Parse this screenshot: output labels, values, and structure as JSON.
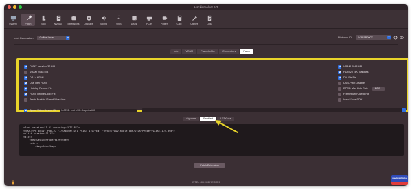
{
  "window": {
    "title": "Hackintool v3.9.3"
  },
  "toolbar": {
    "items": [
      {
        "label": "System",
        "icon": "monitor-icon"
      },
      {
        "label": "Patch",
        "icon": "wrench-icon"
      },
      {
        "label": "Boot",
        "icon": "boot-icon"
      },
      {
        "label": "NVRAM",
        "icon": "nvram-icon"
      },
      {
        "label": "Extensions",
        "icon": "puzzle-icon"
      },
      {
        "label": "Displays",
        "icon": "display-icon"
      },
      {
        "label": "Sound",
        "icon": "speaker-icon"
      },
      {
        "label": "USB",
        "icon": "usb-icon"
      },
      {
        "label": "Disks",
        "icon": "disk-icon"
      },
      {
        "label": "PCIe",
        "icon": "pcie-icon"
      },
      {
        "label": "Power",
        "icon": "power-icon"
      },
      {
        "label": "Calc",
        "icon": "calculator-icon"
      },
      {
        "label": "Utilities",
        "icon": "tools-icon"
      },
      {
        "label": "Logs",
        "icon": "logs-icon"
      }
    ],
    "active_index": 1
  },
  "settings": {
    "intel_generation_label": "Intel Generation",
    "intel_generation_value": "Coffee Lake",
    "platform_id_label": "Platform ID",
    "platform_id_value": "0x3E9B0007"
  },
  "tabs": [
    "Info",
    "VRAM",
    "Framebuffer",
    "Connectors",
    "Patch"
  ],
  "selected_tab": "Patch",
  "options_left": [
    {
      "label": "DVMT-prealloc 32 MB",
      "checked": true
    },
    {
      "label": "VRAM 2048 MB",
      "checked": false
    },
    {
      "label": "DP -> HDMI",
      "checked": true
    },
    {
      "label": "Use Intel HDMI",
      "checked": true
    },
    {
      "label": "Hotplug Reboot Fix",
      "checked": true
    },
    {
      "label": "HDMI Infinite Loop Fix",
      "checked": true
    },
    {
      "label": "Audio Enable IO and WaveHax",
      "checked": false
    }
  ],
  "spoof_option": {
    "label": "Spoof Video Device ID",
    "checked": true,
    "value": "0x3E9B: Intel UHD Graphics 630"
  },
  "options_right": [
    {
      "label": "VRAM 2048 MB",
      "checked": true
    },
    {
      "label": "HDMI20 (4K) patches",
      "checked": true
    },
    {
      "label": "DVI Fix Fix",
      "checked": true
    },
    {
      "label": "USB-Pixel Disable",
      "checked": false
    },
    {
      "label": "DPCD Max Link Rate",
      "checked": false,
      "value": "HBR2"
    },
    {
      "label": "FramebufferCheck Fix",
      "checked": false
    },
    {
      "label": "Insert New GPU",
      "checked": false
    }
  ],
  "subtabs": [
    "Algorate",
    "Enabled",
    "LEDCola"
  ],
  "selected_subtab": "Enabled",
  "code_lines": [
    "<?xml version=\"1.0\" encoding=\"UTF-8\"?>",
    "<!DOCTYPE plist PUBLIC \"-//Apple//DTD PLIST 1.0//EN\" \"http://www.apple.com/DTDs/PropertyList-1.0.dtd\">",
    "<plist version=\"1.0\">",
    "<dict>",
    "    <key>DeviceProperties</key>",
    "    <dict>",
    "        <key>Add</key>"
  ],
  "patch_button_label": "Patch Extension",
  "status_text": "INTEL GLK/GENERIC 9",
  "badge_text": "HACKINTOOL",
  "colors": {
    "highlight": "#e8d42a",
    "accent": "#2f6fe0",
    "window_bg": "#3b2f34"
  }
}
